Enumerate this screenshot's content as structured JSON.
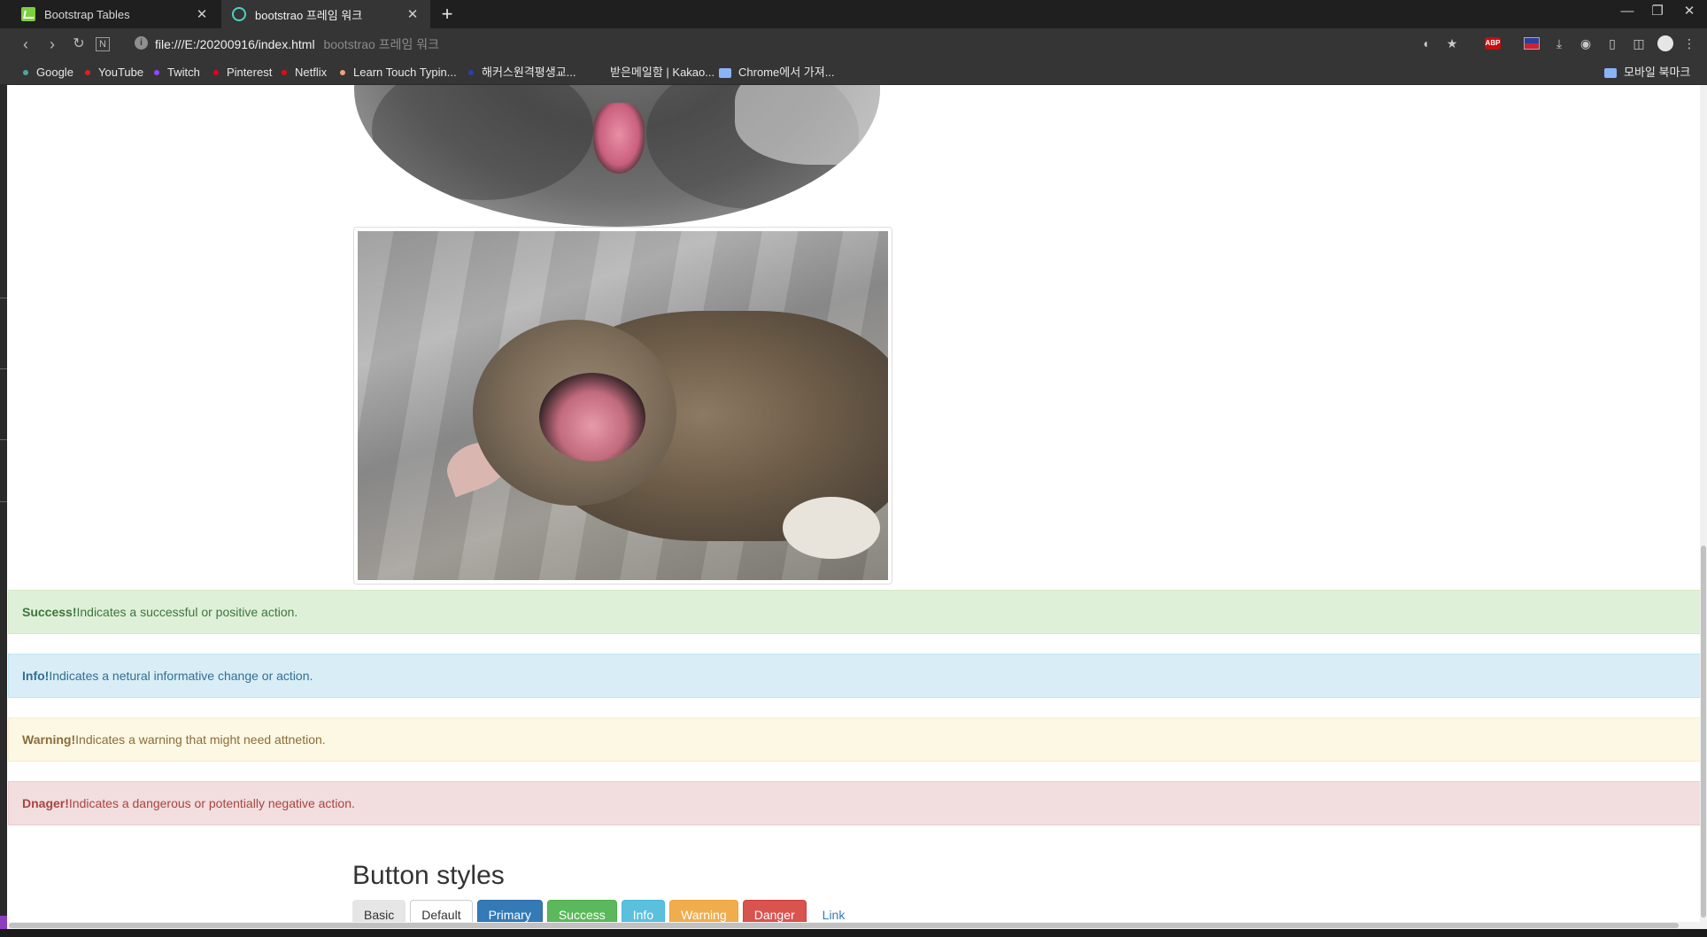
{
  "browser": {
    "tabs": [
      {
        "label": "Bootstrap Tables",
        "active": false
      },
      {
        "label": "bootstrao 프레임 워크",
        "active": true
      }
    ],
    "address": {
      "url": "file:///E:/20200916/index.html",
      "page_title": "bootstrao 프레임 워크"
    },
    "bookmarks": [
      {
        "label": "Google",
        "color": "#4aa8a0"
      },
      {
        "label": "YouTube",
        "color": "#e02020"
      },
      {
        "label": "Twitch",
        "color": "#9147ff"
      },
      {
        "label": "Pinterest",
        "color": "#e60023"
      },
      {
        "label": "Netflix",
        "color": "#e50914"
      },
      {
        "label": "Learn Touch Typin...",
        "color": "#f0a080"
      },
      {
        "label": "해커스원격평생교...",
        "color": "#2a3fb0"
      },
      {
        "label": "받은메일함 | Kakao...",
        "color": "#353535"
      },
      {
        "label": "Chrome에서 가져...",
        "color": "#8ab4f8"
      }
    ],
    "mobile_bookmarks": "모바일 북마크",
    "icons": [
      "back-icon",
      "forward-icon",
      "reload-icon",
      "notion-icon",
      "info-icon",
      "pocket-icon",
      "star-icon",
      "adblock-icon",
      "flag-icon",
      "download-icon",
      "camera-icon",
      "reader-icon",
      "sidebar-icon",
      "profile-icon",
      "menu-icon"
    ]
  },
  "alerts": [
    {
      "type": "success",
      "strong": "Success!",
      "text": "Indicates a successful or positive action."
    },
    {
      "type": "info",
      "strong": "Info!",
      "text": "Indicates a netural informative change or action."
    },
    {
      "type": "warning",
      "strong": "Warning!",
      "text": "Indicates a warning that might need attnetion."
    },
    {
      "type": "danger",
      "strong": "Dnager!",
      "text": "Indicates a dangerous or potentially negative action."
    }
  ],
  "section_title": "Button styles",
  "buttons": [
    {
      "label": "Basic",
      "style": "basic"
    },
    {
      "label": "Default",
      "style": "default"
    },
    {
      "label": "Primary",
      "style": "primary"
    },
    {
      "label": "Success",
      "style": "success"
    },
    {
      "label": "Info",
      "style": "info"
    },
    {
      "label": "Warning",
      "style": "warning"
    },
    {
      "label": "Danger",
      "style": "danger"
    },
    {
      "label": "Link",
      "style": "link"
    }
  ],
  "colors": {
    "primary": "#337ab7",
    "success": "#5cb85c",
    "info": "#5bc0de",
    "warning": "#f0ad4e",
    "danger": "#d9534f"
  }
}
